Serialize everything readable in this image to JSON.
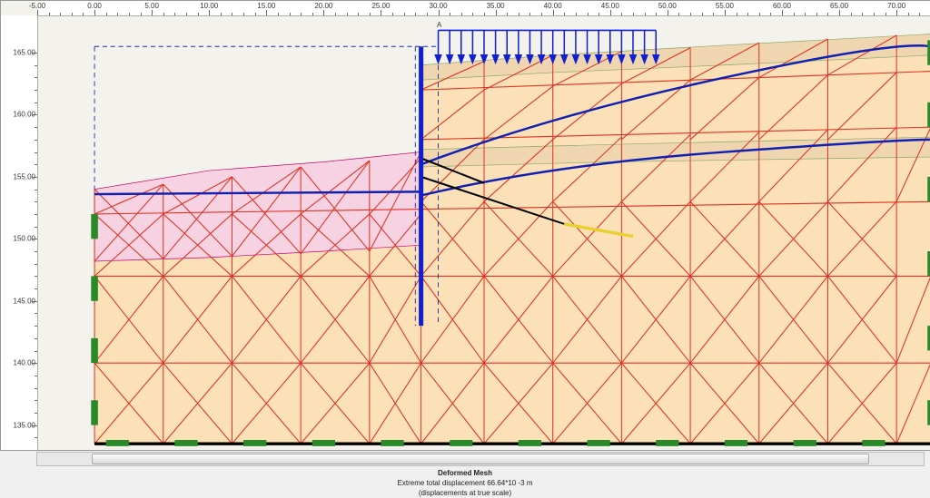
{
  "caption": {
    "line1": "Deformed Mesh",
    "line2": "Extreme total displacement 66.64*10 -3 m",
    "line3": "(displacements at true scale)"
  },
  "load_label": "A",
  "x_ticks": [
    "-5.00",
    "0.00",
    "5.00",
    "10.00",
    "15.00",
    "20.00",
    "25.00",
    "30.00",
    "35.00",
    "40.00",
    "45.00",
    "50.00",
    "55.00",
    "60.00",
    "65.00",
    "70.00"
  ],
  "y_ticks": [
    "165.00",
    "160.00",
    "155.00",
    "150.00",
    "145.00",
    "140.00",
    "135.00"
  ],
  "chart_data": {
    "type": "diagram",
    "description": "Finite-element deformed mesh (2D plane-strain) of retaining wall with surcharge and tieback anchors",
    "x_range": [
      -5,
      73
    ],
    "y_range": [
      133,
      168
    ],
    "wall": {
      "x": 28.5,
      "y_top": 165.5,
      "y_bottom": 143.0
    },
    "surcharge": {
      "label": "A",
      "x_start": 30,
      "x_end": 49,
      "y": 166.2
    },
    "ground_left": {
      "y_start": 154.0,
      "y_end_at_wall": 156.5
    },
    "ground_right": {
      "y_at_wall": 164.0,
      "y_at_right": 166.5
    },
    "anchors": [
      {
        "from": [
          28.5,
          155
        ],
        "to": [
          41,
          151
        ]
      },
      {
        "from": [
          28.5,
          156
        ],
        "to": [
          47,
          150.5
        ]
      }
    ],
    "initial_outline_rect": {
      "x0": 0,
      "y0": 165.5,
      "x1": 30,
      "y1": 143
    },
    "model_bottom_y": 133.5,
    "model_left_x": 0,
    "model_right_x": 73
  }
}
